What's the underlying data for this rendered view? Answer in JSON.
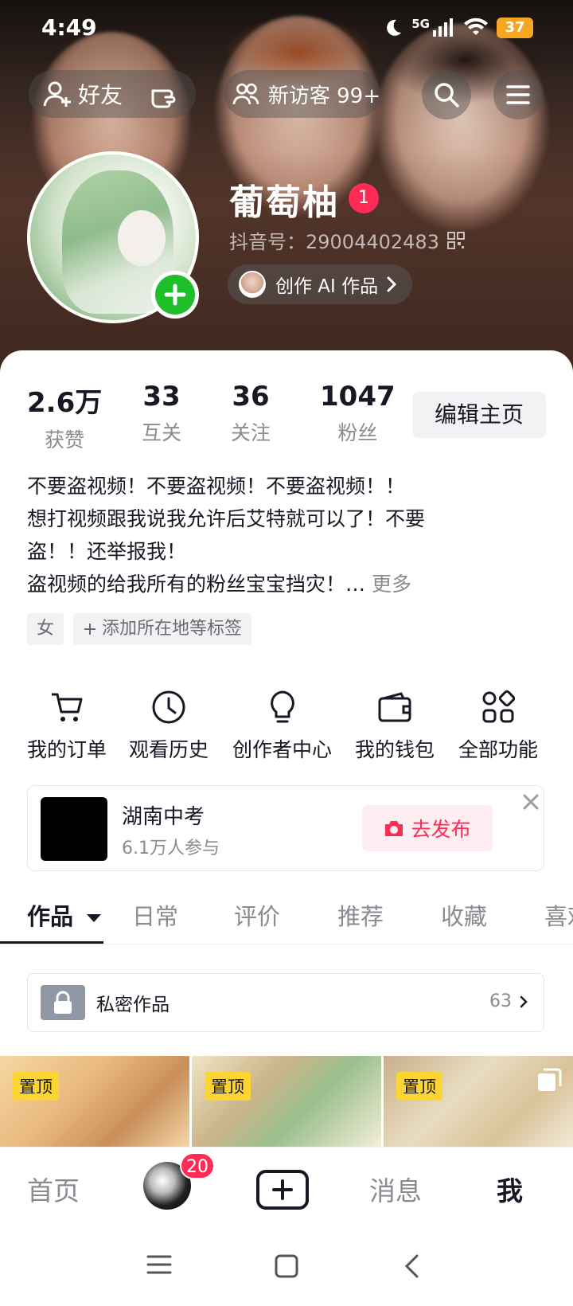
{
  "status_bar": {
    "time": "4:49",
    "network": "5G",
    "battery": "37"
  },
  "header": {
    "friends_label": "好友",
    "visitors_label": "新访客 99+",
    "nickname": "葡萄柚",
    "nickname_badge": "1",
    "douyin_id": "抖音号：29004402483",
    "ai_label": "创作 AI 作品"
  },
  "stats": [
    {
      "num": "2.6万",
      "label": "获赞"
    },
    {
      "num": "33",
      "label": "互关"
    },
    {
      "num": "36",
      "label": "关注"
    },
    {
      "num": "1047",
      "label": "粉丝"
    }
  ],
  "edit_label": "编辑主页",
  "bio": {
    "line1": "不要盗视频！不要盗视频！不要盗视频！！",
    "line2": "想打视频跟我说我允许后艾特就可以了！不要",
    "line3": "盗！！还举报我！",
    "line4": "盗视频的给我所有的粉丝宝宝挡灾！…",
    "more": "更多"
  },
  "tags": {
    "gender": "女",
    "add": "添加所在地等标签"
  },
  "functions": [
    {
      "label": "我的订单",
      "icon": "cart-icon"
    },
    {
      "label": "观看历史",
      "icon": "clock-icon"
    },
    {
      "label": "创作者中心",
      "icon": "bulb-icon"
    },
    {
      "label": "我的钱包",
      "icon": "wallet-icon"
    },
    {
      "label": "全部功能",
      "icon": "apps-icon"
    }
  ],
  "topic": {
    "title": "湖南中考",
    "participants": "6.1万人参与",
    "button": "去发布"
  },
  "tabs": [
    "作品",
    "日常",
    "评价",
    "推荐",
    "收藏",
    "喜欢"
  ],
  "private_works": {
    "label": "私密作品",
    "count": "63"
  },
  "pin_label": "置顶",
  "bottom_nav": {
    "home": "首页",
    "badge": "20",
    "messages": "消息",
    "me": "我"
  }
}
